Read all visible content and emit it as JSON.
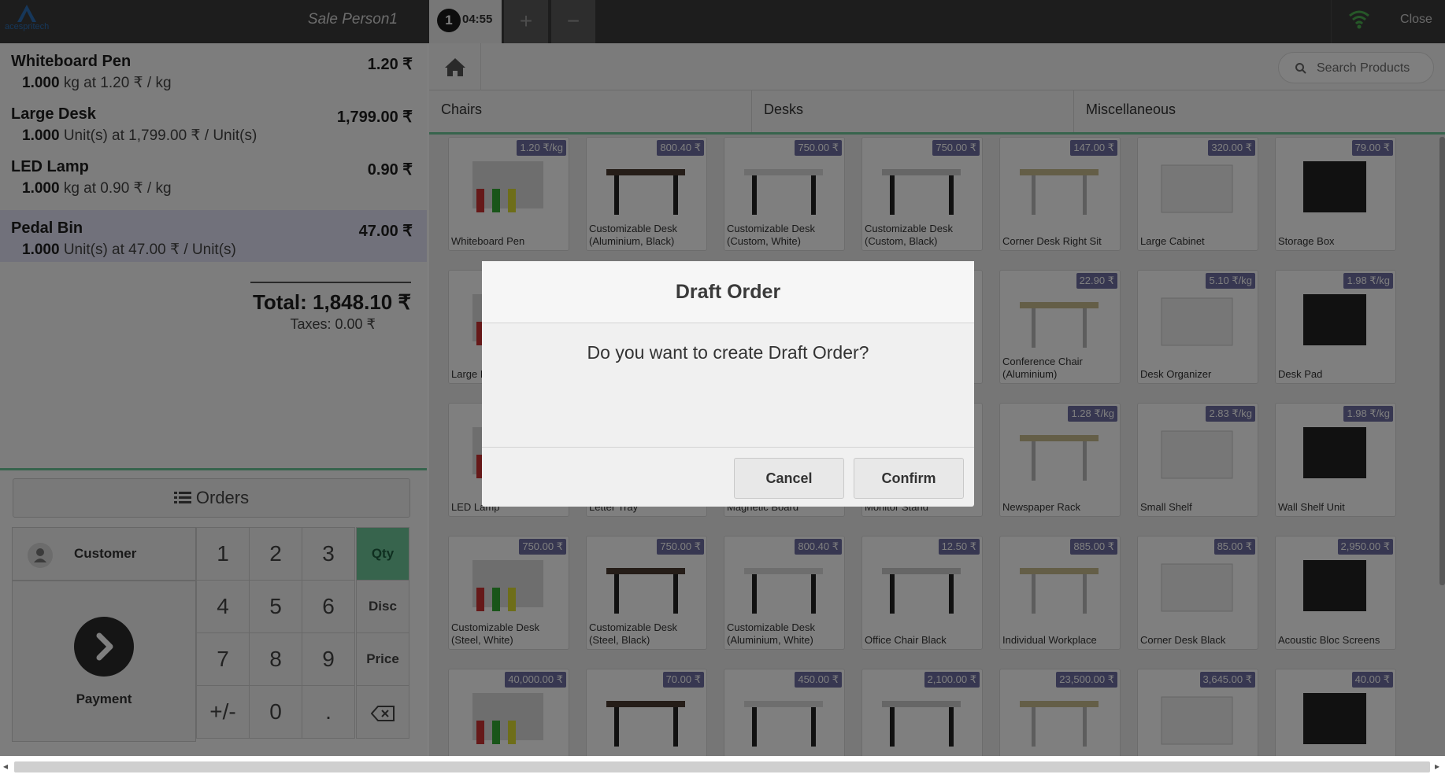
{
  "topbar": {
    "logo_text": "acespritech",
    "salesperson": "Sale Person1",
    "order_number": "1",
    "order_time": "04:55",
    "add_label": "+",
    "remove_label": "−",
    "close_label": "Close"
  },
  "orderlines": [
    {
      "name": "Whiteboard Pen",
      "price": "1.20 ₹",
      "qty": "1.000",
      "detail": "kg at 1.20 ₹ / kg"
    },
    {
      "name": "Large Desk",
      "price": "1,799.00 ₹",
      "qty": "1.000",
      "detail": "Unit(s) at 1,799.00 ₹ / Unit(s)"
    },
    {
      "name": "LED Lamp",
      "price": "0.90 ₹",
      "qty": "1.000",
      "detail": "kg at 0.90 ₹ / kg"
    },
    {
      "name": "Pedal Bin",
      "price": "47.00 ₹",
      "qty": "1.000",
      "detail": "Unit(s) at 47.00 ₹ / Unit(s)"
    }
  ],
  "summary": {
    "total": "Total: 1,848.10 ₹",
    "taxes": "Taxes: 0.00 ₹"
  },
  "actions": {
    "orders": "Orders",
    "customer": "Customer",
    "payment": "Payment"
  },
  "numpad": {
    "keys": [
      "1",
      "2",
      "3",
      "4",
      "5",
      "6",
      "7",
      "8",
      "9",
      "+/-",
      "0",
      "."
    ],
    "qty": "Qty",
    "disc": "Disc",
    "price": "Price"
  },
  "search": {
    "placeholder": "Search Products"
  },
  "categories": [
    "Chairs",
    "Desks",
    "Miscellaneous"
  ],
  "products": [
    {
      "name": "Whiteboard Pen",
      "price": "1.20 ₹/kg"
    },
    {
      "name": "Customizable Desk (Aluminium, Black)",
      "price": "800.40 ₹"
    },
    {
      "name": "Customizable Desk (Custom, White)",
      "price": "750.00 ₹"
    },
    {
      "name": "Customizable Desk (Custom, Black)",
      "price": "750.00 ₹"
    },
    {
      "name": "Corner Desk Right Sit",
      "price": "147.00 ₹"
    },
    {
      "name": "Large Cabinet",
      "price": "320.00 ₹"
    },
    {
      "name": "Storage Box",
      "price": "79.00 ₹"
    },
    {
      "name": "Large Desk",
      "price": ""
    },
    {
      "name": "",
      "price": ""
    },
    {
      "name": "",
      "price": ""
    },
    {
      "name": "",
      "price": ""
    },
    {
      "name": "Conference Chair (Aluminium)",
      "price": "22.90 ₹"
    },
    {
      "name": "Desk Organizer",
      "price": "5.10 ₹/kg"
    },
    {
      "name": "Desk Pad",
      "price": "1.98 ₹/kg"
    },
    {
      "name": "LED Lamp",
      "price": ""
    },
    {
      "name": "Letter Tray",
      "price": ""
    },
    {
      "name": "Magnetic Board",
      "price": ""
    },
    {
      "name": "Monitor Stand",
      "price": ""
    },
    {
      "name": "Newspaper Rack",
      "price": "1.28 ₹/kg"
    },
    {
      "name": "Small Shelf",
      "price": "2.83 ₹/kg"
    },
    {
      "name": "Wall Shelf Unit",
      "price": "1.98 ₹/kg"
    },
    {
      "name": "Customizable Desk (Steel, White)",
      "price": "750.00 ₹"
    },
    {
      "name": "Customizable Desk (Steel, Black)",
      "price": "750.00 ₹"
    },
    {
      "name": "Customizable Desk (Aluminium, White)",
      "price": "800.40 ₹"
    },
    {
      "name": "Office Chair Black",
      "price": "12.50 ₹"
    },
    {
      "name": "Individual Workplace",
      "price": "885.00 ₹"
    },
    {
      "name": "Corner Desk Black",
      "price": "85.00 ₹"
    },
    {
      "name": "Acoustic Bloc Screens",
      "price": "2,950.00 ₹"
    },
    {
      "name": "",
      "price": "40,000.00 ₹"
    },
    {
      "name": "",
      "price": "70.00 ₹"
    },
    {
      "name": "",
      "price": "450.00 ₹"
    },
    {
      "name": "",
      "price": "2,100.00 ₹"
    },
    {
      "name": "",
      "price": "23,500.00 ₹"
    },
    {
      "name": "",
      "price": "3,645.00 ₹"
    },
    {
      "name": "",
      "price": "40.00 ₹"
    }
  ],
  "dialog": {
    "title": "Draft Order",
    "body": "Do you want to create Draft Order?",
    "cancel": "Cancel",
    "confirm": "Confirm"
  },
  "colors": {
    "accent": "#6ec89b",
    "price_badge": "#6f6fa3",
    "selected_line": "#e3e3f6"
  }
}
